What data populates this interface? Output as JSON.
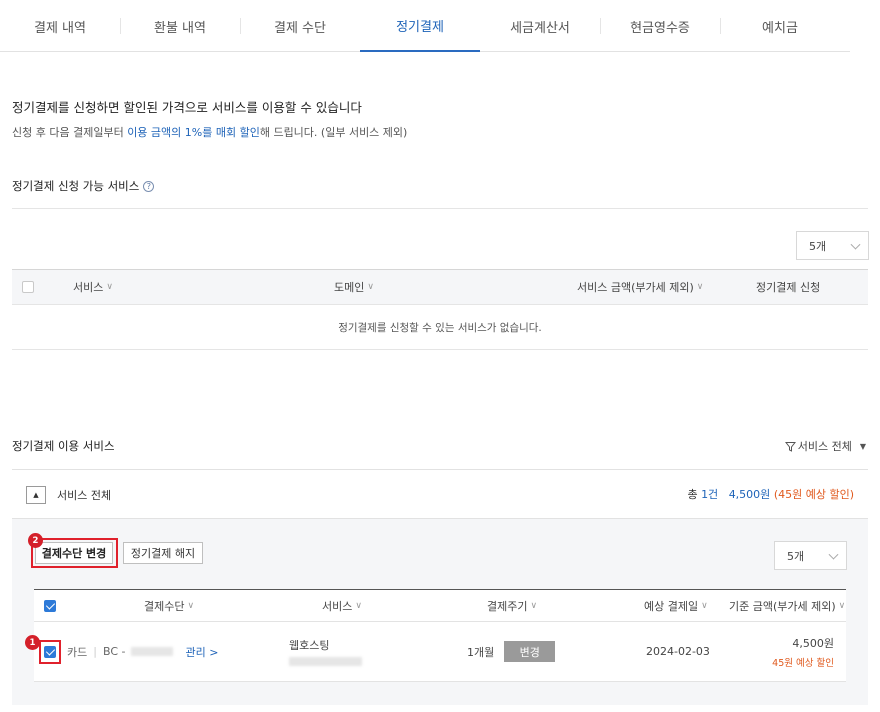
{
  "tabs": [
    "결제 내역",
    "환불 내역",
    "결제 수단",
    "정기결제",
    "세금계산서",
    "현금영수증",
    "예치금"
  ],
  "promo": {
    "title": "정기결제를 신청하면 할인된 가격으로 서비스를 이용할 수 있습니다",
    "sub_prefix": "신청 후 다음 결제일부터 ",
    "sub_highlight": "이용 금액의 1%를 매회 할인",
    "sub_suffix": "해 드립니다. (일부 서비스 제외)"
  },
  "available": {
    "title": "정기결제 신청 가능 서비스",
    "help_glyph": "?",
    "page_size": "5개",
    "columns": [
      "서비스",
      "도메인",
      "서비스 금액(부가세 제외)",
      "정기결제 신청"
    ],
    "empty_message": "정기결제를 신청할 수 있는 서비스가 없습니다."
  },
  "active": {
    "title": "정기결제 이용 서비스",
    "filter_label": "서비스 전체",
    "group_toggle_glyph": "▲",
    "group_label": "서비스 전체",
    "summary": {
      "total_prefix": "총 ",
      "count": "1건",
      "amount": "4,500원",
      "discount": "(45원 예상 할인)"
    },
    "change_method_button": "결제수단 변경",
    "cancel_button": "정기결제 해지",
    "page_size": "5개",
    "columns": [
      "결제수단",
      "서비스",
      "결제주기",
      "예상 결제일",
      "기준 금액(부가세 제외)"
    ],
    "row": {
      "method_type": "카드",
      "card_prefix": "BC -",
      "manage_label": "관리 >",
      "service_name": "웹호스팅",
      "cycle": "1개월",
      "change_label": "변경",
      "expected_date": "2024-02-03",
      "amount": "4,500원",
      "discount_note": "45원 예상 할인"
    }
  },
  "annotations": {
    "badge_1": "1",
    "badge_2": "2",
    "highlight_color": "#e0212c"
  },
  "colors": {
    "accent": "#1e63b8",
    "discount": "#e0591d",
    "checkbox": "#2d7ad8"
  }
}
